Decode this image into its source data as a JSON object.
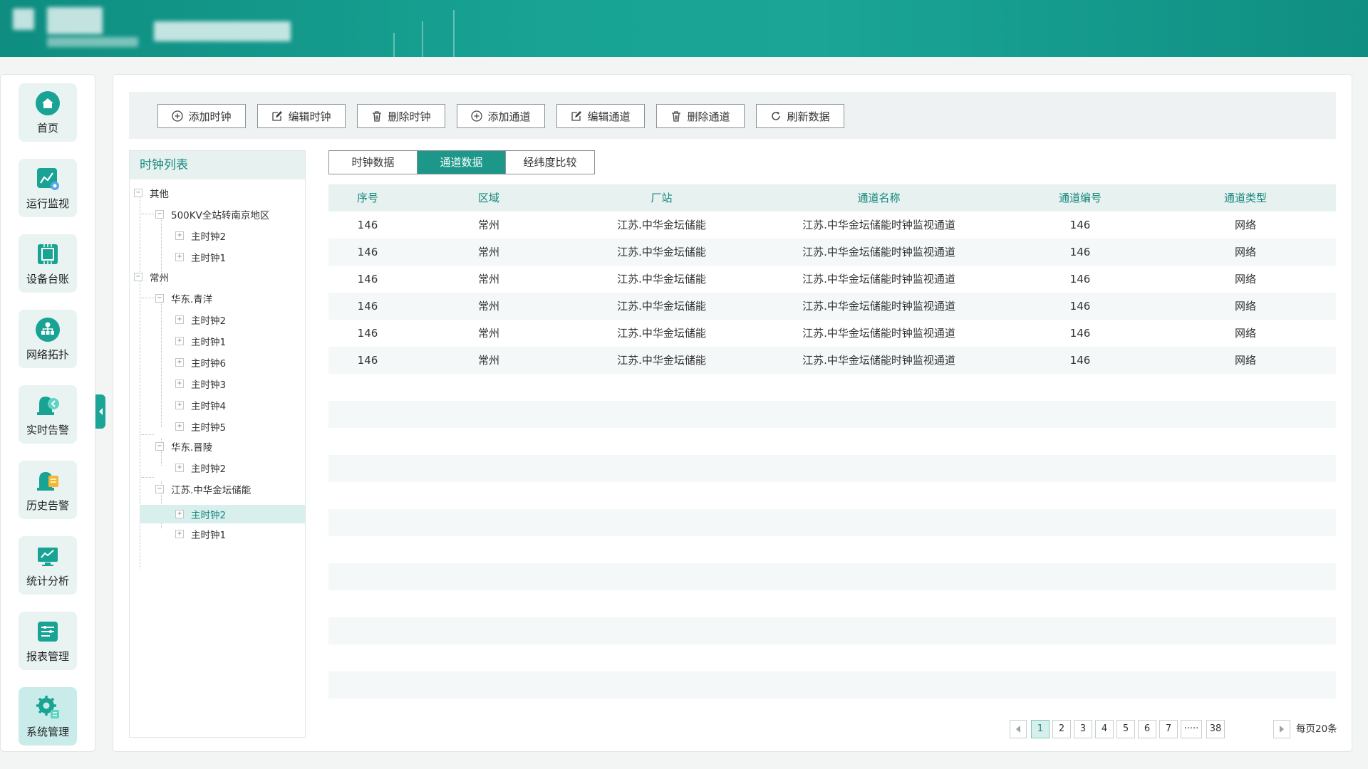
{
  "colors": {
    "accent": "#1aa597",
    "accent_dark": "#15877b",
    "header_bg": "#12998b"
  },
  "sidebar": {
    "items": [
      {
        "label": "首页",
        "icon": "home-icon"
      },
      {
        "label": "运行监视",
        "icon": "monitor-chart-icon"
      },
      {
        "label": "设备台账",
        "icon": "device-ledger-icon"
      },
      {
        "label": "网络拓扑",
        "icon": "network-topology-icon"
      },
      {
        "label": "实时告警",
        "icon": "realtime-alarm-icon"
      },
      {
        "label": "历史告警",
        "icon": "history-alarm-icon"
      },
      {
        "label": "统计分析",
        "icon": "statistics-icon"
      },
      {
        "label": "报表管理",
        "icon": "report-icon"
      },
      {
        "label": "系统管理",
        "icon": "system-settings-icon",
        "active": true
      }
    ]
  },
  "toolbar": {
    "add_clock": "添加时钟",
    "edit_clock": "编辑时钟",
    "delete_clock": "删除时钟",
    "add_channel": "添加通道",
    "edit_channel": "编辑通道",
    "delete_channel": "删除通道",
    "refresh": "刷新数据"
  },
  "tree": {
    "title": "时钟列表",
    "nodes": [
      "其他",
      "500KV全站转南京地区",
      "主时钟2",
      "主时钟1",
      "常州",
      "华东.青洋",
      "主时钟2",
      "主时钟1",
      "主时钟6",
      "主时钟3",
      "主时钟4",
      "主时钟5",
      "华东.晋陵",
      "主时钟2",
      "江苏.中华金坛储能",
      "主时钟2",
      "主时钟1"
    ],
    "selected_index": 15
  },
  "tabs": [
    "时钟数据",
    "通道数据",
    "经纬度比较"
  ],
  "active_tab": 1,
  "table": {
    "headers": [
      "序号",
      "区域",
      "厂站",
      "通道名称",
      "通道编号",
      "通道类型"
    ],
    "rows": [
      [
        "146",
        "常州",
        "江苏.中华金坛储能",
        "江苏.中华金坛储能时钟监视通道",
        "146",
        "网络"
      ],
      [
        "146",
        "常州",
        "江苏.中华金坛储能",
        "江苏.中华金坛储能时钟监视通道",
        "146",
        "网络"
      ],
      [
        "146",
        "常州",
        "江苏.中华金坛储能",
        "江苏.中华金坛储能时钟监视通道",
        "146",
        "网络"
      ],
      [
        "146",
        "常州",
        "江苏.中华金坛储能",
        "江苏.中华金坛储能时钟监视通道",
        "146",
        "网络"
      ],
      [
        "146",
        "常州",
        "江苏.中华金坛储能",
        "江苏.中华金坛储能时钟监视通道",
        "146",
        "网络"
      ],
      [
        "146",
        "常州",
        "江苏.中华金坛储能",
        "江苏.中华金坛储能时钟监视通道",
        "146",
        "网络"
      ]
    ]
  },
  "pagination": {
    "pages": [
      "1",
      "2",
      "3",
      "4",
      "5",
      "6",
      "7",
      "·····",
      "38"
    ],
    "current": "1",
    "per_page_label": "每页20条"
  }
}
